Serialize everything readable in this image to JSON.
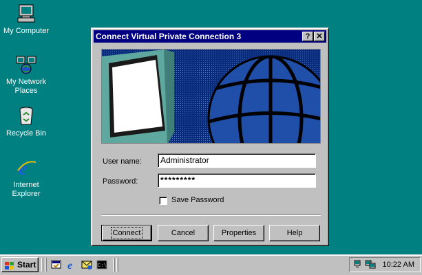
{
  "desktop": {
    "icons": [
      {
        "label": "My Computer"
      },
      {
        "label": "My Network Places"
      },
      {
        "label": "Recycle Bin"
      },
      {
        "label": "Internet Explorer"
      }
    ]
  },
  "dialog": {
    "title": "Connect Virtual Private Connection 3",
    "help_btn": "?",
    "close_btn": "✕",
    "username_label": "User name:",
    "username_value": "Administrator",
    "password_label": "Password:",
    "password_value": "*********",
    "save_password_label": "Save Password",
    "save_password_checked": false,
    "buttons": {
      "connect": "Connect",
      "cancel": "Cancel",
      "properties": "Properties",
      "help": "Help"
    }
  },
  "taskbar": {
    "start_label": "Start",
    "clock": "10:22 AM"
  },
  "colors": {
    "desktop": "#008080",
    "titlebar": "#000080",
    "banner_blue": "#0a2a7a",
    "banner_teal": "#5fa8a0"
  }
}
